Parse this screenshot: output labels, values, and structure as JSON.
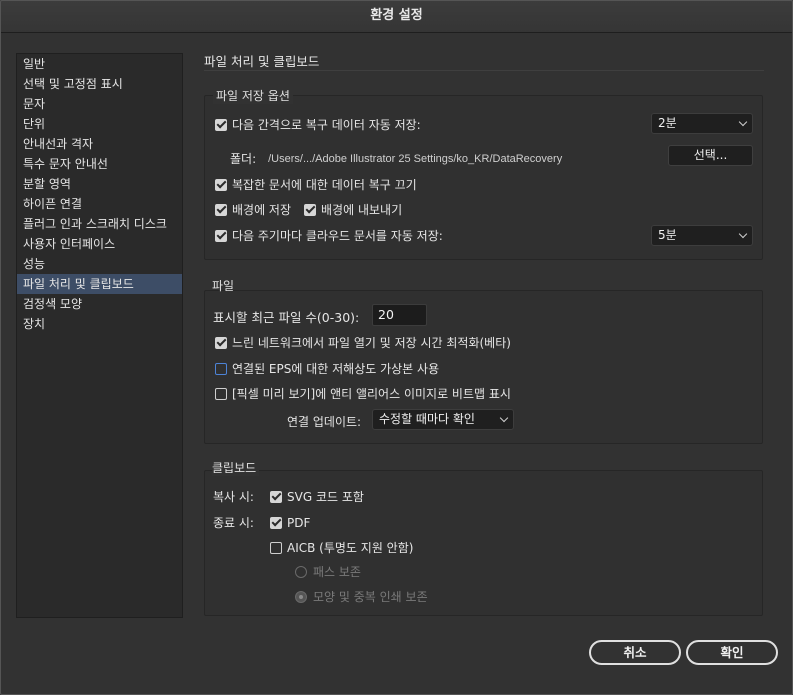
{
  "window": {
    "title": "환경 설정"
  },
  "sidebar": {
    "items": [
      {
        "label": "일반"
      },
      {
        "label": "선택 및 고정점 표시"
      },
      {
        "label": "문자"
      },
      {
        "label": "단위"
      },
      {
        "label": "안내선과 격자"
      },
      {
        "label": "특수 문자 안내선"
      },
      {
        "label": "분할 영역"
      },
      {
        "label": "하이픈 연결"
      },
      {
        "label": "플러그 인과 스크래치 디스크"
      },
      {
        "label": "사용자 인터페이스"
      },
      {
        "label": "성능"
      },
      {
        "label": "파일 처리 및 클립보드"
      },
      {
        "label": "검정색 모양"
      },
      {
        "label": "장치"
      }
    ],
    "selected": "파일 처리 및 클립보드"
  },
  "main": {
    "title": "파일 처리 및 클립보드",
    "save_options": {
      "label": "파일 저장 옵션",
      "autosave_label": "다음 간격으로 복구 데이터 자동 저장:",
      "autosave_checked": true,
      "autosave_interval": "2분",
      "folder_label": "폴더:",
      "folder_path": "/Users/.../Adobe Illustrator 25 Settings/ko_KR/DataRecovery",
      "choose_button": "선택...",
      "complex_docs_label": "복잡한 문서에 대한 데이터 복구 끄기",
      "complex_docs_checked": true,
      "bg_save_label": "배경에 저장",
      "bg_save_checked": true,
      "bg_export_label": "배경에 내보내기",
      "bg_export_checked": true,
      "cloud_autosave_label": "다음 주기마다 클라우드 문서를 자동 저장:",
      "cloud_autosave_checked": true,
      "cloud_interval": "5분"
    },
    "files": {
      "label": "파일",
      "recent_label": "표시할 최근 파일 수(0-30):",
      "recent_value": "20",
      "slow_network_label": "느린 네트워크에서 파일 열기 및 저장 시간 최적화(베타)",
      "slow_network_checked": true,
      "linked_eps_label": "연결된 EPS에 대한 저해상도 가상본 사용",
      "linked_eps_checked": false,
      "pixel_preview_label": "[픽셀 미리 보기]에 앤티 앨리어스 이미지로 비트맵 표시",
      "pixel_preview_checked": false,
      "update_links_label": "연결 업데이트:",
      "update_links_value": "수정할 때마다 확인"
    },
    "clipboard": {
      "label": "클립보드",
      "copy_label": "복사 시:",
      "svg_label": "SVG 코드 포함",
      "svg_checked": true,
      "quit_label": "종료 시:",
      "pdf_label": "PDF",
      "pdf_checked": true,
      "aicb_label": "AICB (투명도 지원 안함)",
      "aicb_checked": false,
      "preserve_paths_label": "패스 보존",
      "preserve_appearance_label": "모양 및 중복 인쇄 보존"
    }
  },
  "footer": {
    "cancel_label": "취소",
    "ok_label": "확인"
  },
  "colors": {
    "background": "#323232",
    "sidebar_bg": "#2a2a2a",
    "selection": "#3d4d66",
    "focus_blue": "#4d83d6"
  }
}
